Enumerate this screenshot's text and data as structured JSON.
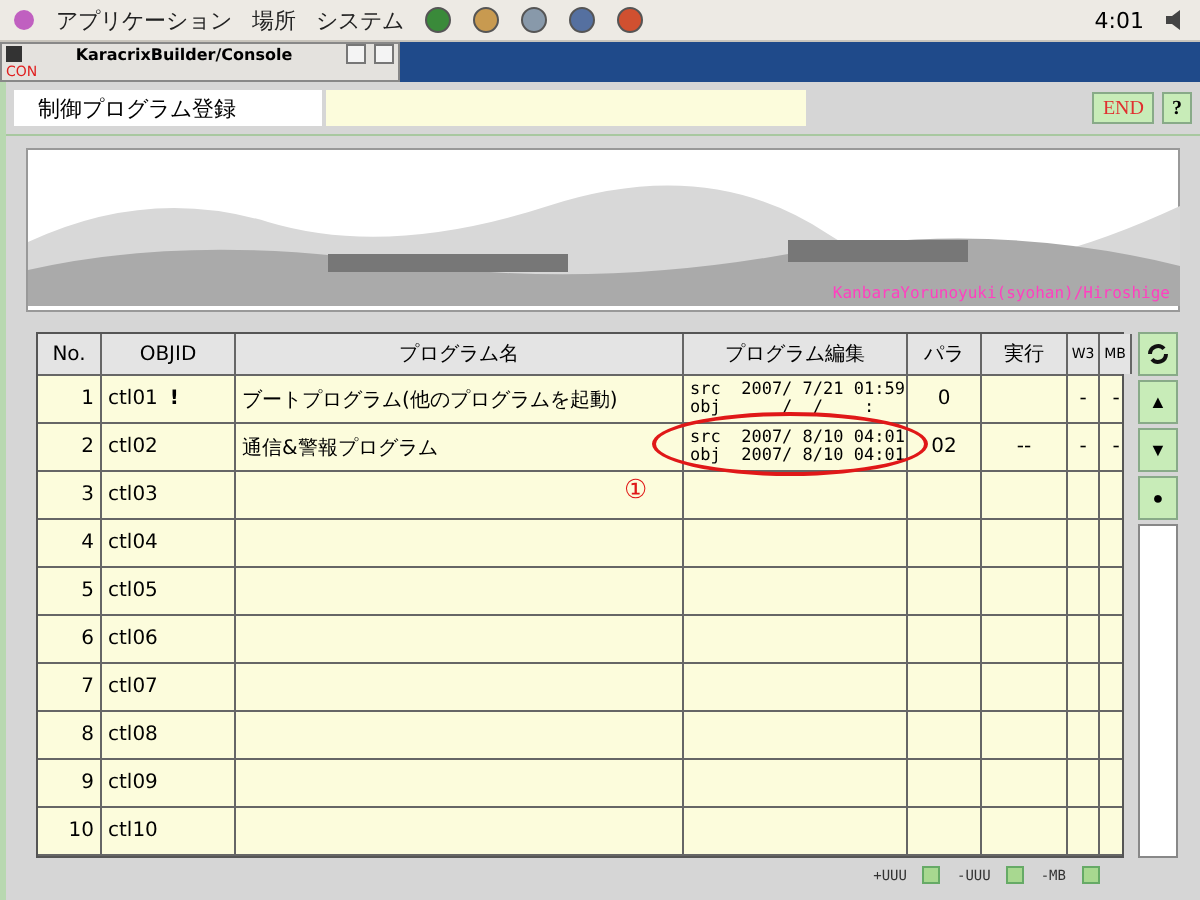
{
  "top_panel": {
    "menus": [
      "アプリケーション",
      "場所",
      "システム"
    ],
    "clock": "4:01"
  },
  "console_window": {
    "title": "KaracrixBuilder/Console",
    "toolbar_label": "CON"
  },
  "app": {
    "title": "制御プログラム登録",
    "buttons": [
      {
        "kind": "end",
        "label": "END"
      },
      {
        "kind": "help",
        "label": "?"
      }
    ]
  },
  "banner": {
    "caption": "KanbaraYorunoyuki(syohan)/Hiroshige"
  },
  "table": {
    "columns": [
      "No.",
      "OBJID",
      "プログラム名",
      "プログラム編集",
      "パラ",
      "実行",
      "W3",
      "MB"
    ],
    "rows": [
      {
        "no": "1",
        "objid": "ctl01",
        "flag": "!",
        "name": "ブートプログラム(他のプログラムを起動)",
        "src": "src  2007/ 7/21 01:59",
        "obj": "obj      /  /    :",
        "para": "0",
        "w3": "-",
        "mb": "-",
        "circled": false
      },
      {
        "no": "2",
        "objid": "ctl02",
        "name": "通信&警報プログラム",
        "src": "src  2007/ 8/10 04:01",
        "obj": "obj  2007/ 8/10 04:01",
        "para": "02",
        "exec": "--",
        "w3": "-",
        "mb": "-",
        "circled": true
      },
      {
        "no": "3",
        "objid": "ctl03",
        "circled": false
      },
      {
        "no": "4",
        "objid": "ctl04",
        "circled": false
      },
      {
        "no": "5",
        "objid": "ctl05",
        "circled": false
      },
      {
        "no": "6",
        "objid": "ctl06",
        "circled": false
      },
      {
        "no": "7",
        "objid": "ctl07",
        "circled": false
      },
      {
        "no": "8",
        "objid": "ctl08",
        "circled": false
      },
      {
        "no": "9",
        "objid": "ctl09",
        "circled": false
      },
      {
        "no": "10",
        "objid": "ctl10",
        "circled": false
      }
    ]
  },
  "annotation": {
    "label": "①"
  },
  "side_buttons": [
    {
      "kind": "refresh"
    },
    {
      "kind": "up",
      "label": "▲"
    },
    {
      "kind": "down",
      "label": "▼"
    },
    {
      "kind": "dot",
      "label": "●"
    }
  ],
  "footer": [
    {
      "label": "+UUU"
    },
    {
      "label": "-UUU"
    },
    {
      "label": "-MB"
    }
  ]
}
